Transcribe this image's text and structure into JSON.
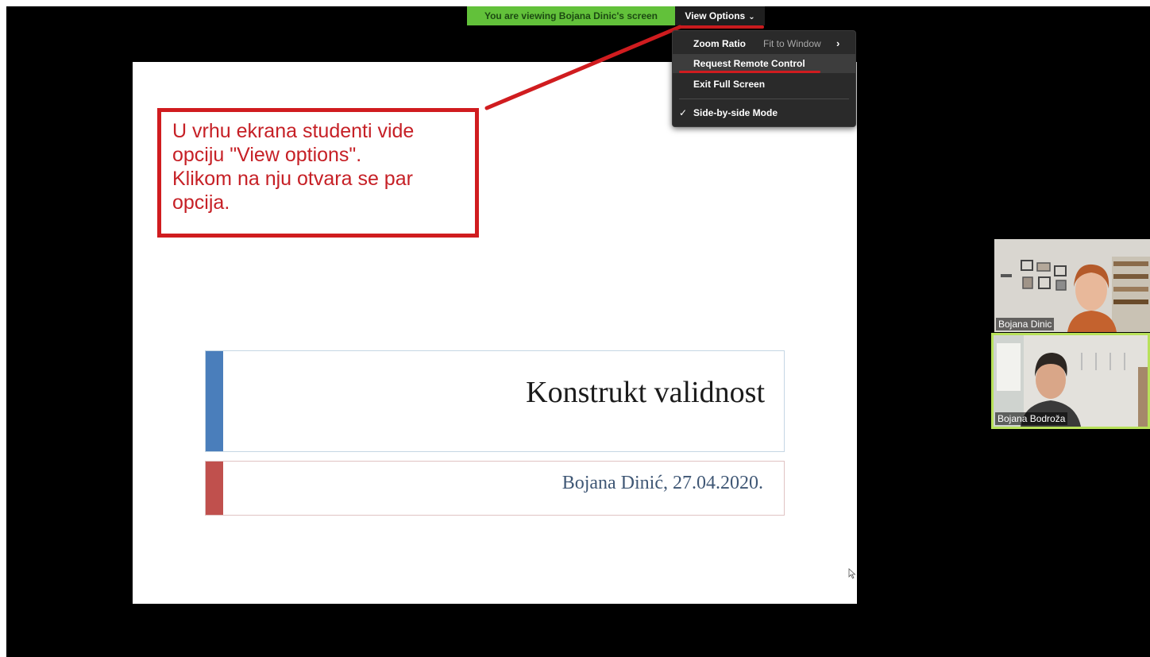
{
  "share_banner": {
    "text": "You are viewing Bojana Dinic's screen",
    "color": "#62c13a"
  },
  "view_options": {
    "label": "View Options",
    "chevron_icon": "chevron-down-icon"
  },
  "menu": {
    "zoom_ratio_label": "Zoom Ratio",
    "zoom_ratio_value": "Fit to Window",
    "zoom_arrow_icon": "chevron-right-icon",
    "request_remote_label": "Request Remote Control",
    "exit_fullscreen_label": "Exit Full Screen",
    "side_by_side_label": "Side-by-side Mode",
    "side_by_side_checked": true,
    "check_icon": "checkmark-icon"
  },
  "annotation": {
    "text": "U vrhu ekrana studenti vide\nopciju \"View options\".\nKlikom na nju otvara se par\nopcija.",
    "color": "#d01c1f"
  },
  "slide": {
    "title": "Konstrukt validnost",
    "subtitle": "Bojana Dinić, 27.04.2020.",
    "title_accent_color": "#4a7ebb",
    "subtitle_accent_color": "#c0504d"
  },
  "participants": [
    {
      "name": "Bojana Dinic",
      "active_speaker": false
    },
    {
      "name": "Bojana Bodroža",
      "active_speaker": true
    }
  ]
}
